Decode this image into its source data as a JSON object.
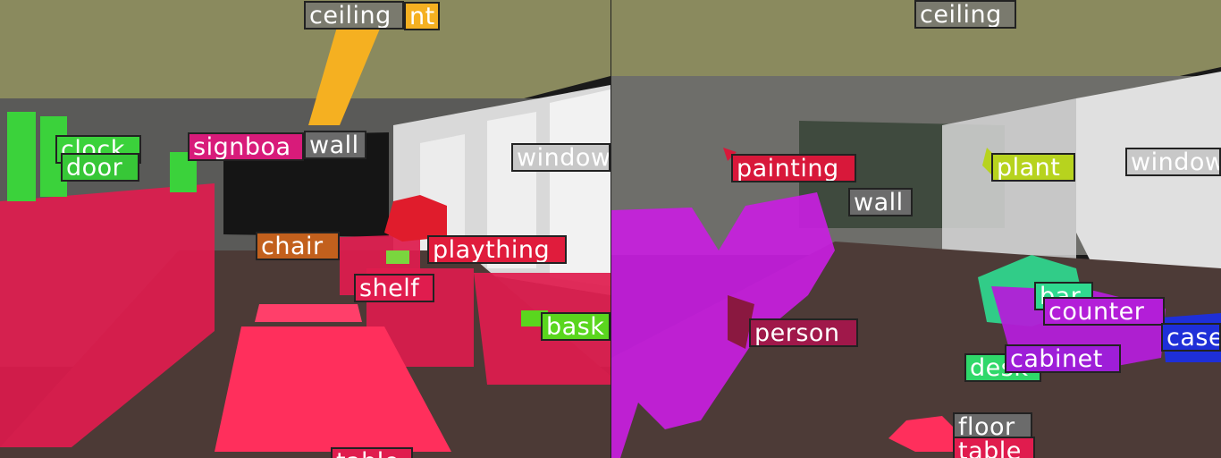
{
  "left_panel": {
    "labels": [
      {
        "id": "ceiling-label-left",
        "text": "ceiling",
        "color": "#7a7a6e"
      },
      {
        "id": "light-label-left",
        "text": "nt",
        "color": "#f5b021"
      },
      {
        "id": "clock-label",
        "text": "clock",
        "color": "#3bd23b"
      },
      {
        "id": "door-label",
        "text": "door",
        "color": "#37c737"
      },
      {
        "id": "signboard-label",
        "text": "signboa",
        "color": "#d81b7a"
      },
      {
        "id": "wall-label-left",
        "text": "wall",
        "color": "#6b6b6b"
      },
      {
        "id": "window-label-left",
        "text": "window",
        "color": "#c8c8c8"
      },
      {
        "id": "chair-label",
        "text": "chair",
        "color": "#c2601d"
      },
      {
        "id": "plaything-label",
        "text": "plaything",
        "color": "#e01c3c"
      },
      {
        "id": "shelf-label",
        "text": "shelf",
        "color": "#e01c4e"
      },
      {
        "id": "basket-label",
        "text": "bask",
        "color": "#5ad61e"
      },
      {
        "id": "table-label-left",
        "text": "table",
        "color": "#e01c4e"
      }
    ]
  },
  "right_panel": {
    "labels": [
      {
        "id": "ceiling-label-right",
        "text": "ceiling",
        "color": "#7a7a6e"
      },
      {
        "id": "painting-label",
        "text": "painting",
        "color": "#d8183a"
      },
      {
        "id": "wall-label-right",
        "text": "wall",
        "color": "#6b6b6b"
      },
      {
        "id": "plant-label",
        "text": "plant",
        "color": "#b7d31e"
      },
      {
        "id": "window-label-right",
        "text": "window",
        "color": "#c8c8c8"
      },
      {
        "id": "bar-label",
        "text": "bar",
        "color": "#2fd98f"
      },
      {
        "id": "counter-label",
        "text": "counter",
        "color": "#b31ed8"
      },
      {
        "id": "case-label",
        "text": "case",
        "color": "#1e2fd8"
      },
      {
        "id": "person-label",
        "text": "person",
        "color": "#a0184a"
      },
      {
        "id": "desk-label",
        "text": "desk",
        "color": "#2fd86a"
      },
      {
        "id": "cabinet-label",
        "text": "cabinet",
        "color": "#9e1ed8"
      },
      {
        "id": "floor-label",
        "text": "floor",
        "color": "#6b6b6b"
      },
      {
        "id": "table-label-right",
        "text": "table",
        "color": "#e01c4e"
      }
    ]
  }
}
